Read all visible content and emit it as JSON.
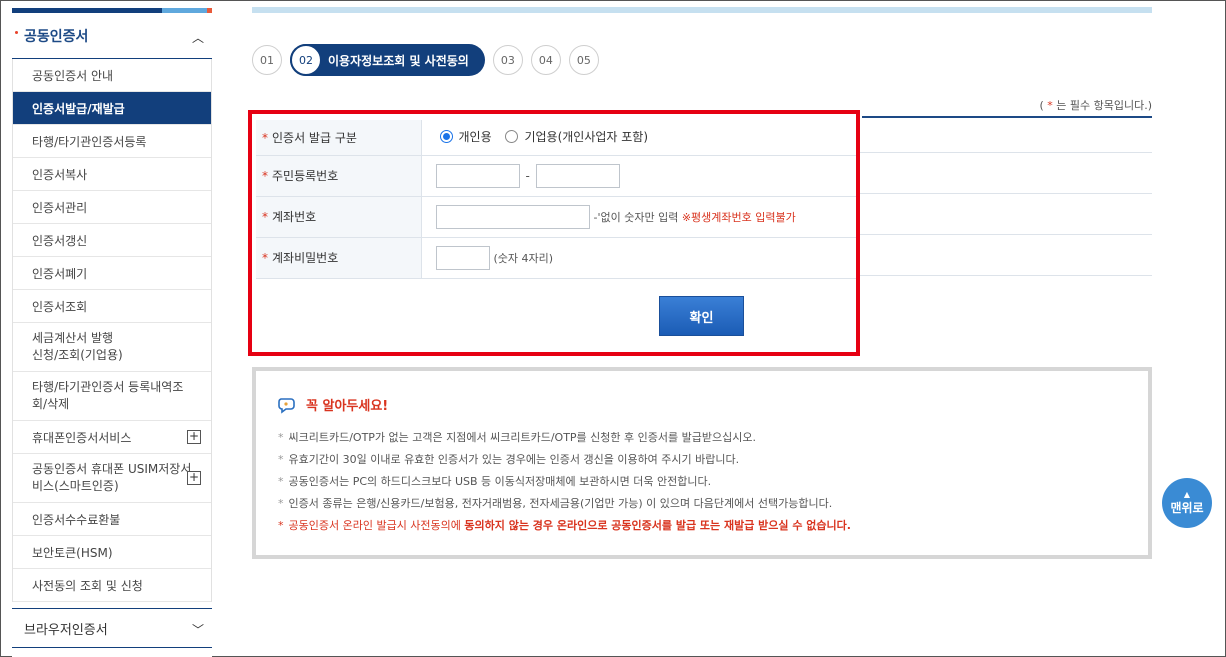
{
  "sidebar": {
    "header": "공동인증서",
    "items": [
      {
        "label": "공동인증서 안내"
      },
      {
        "label": "인증서발급/재발급"
      },
      {
        "label": "타행/타기관인증서등록"
      },
      {
        "label": "인증서복사"
      },
      {
        "label": "인증서관리"
      },
      {
        "label": "인증서갱신"
      },
      {
        "label": "인증서폐기"
      },
      {
        "label": "인증서조회"
      },
      {
        "label": "세금계산서 발행\n신청/조회(기업용)"
      },
      {
        "label": "타행/타기관인증서 등록내역조\n회/삭제"
      },
      {
        "label": "휴대폰인증서서비스"
      },
      {
        "label": "공동인증서 휴대폰 USIM저장서\n비스(스마트인증)"
      },
      {
        "label": "인증서수수료환불"
      },
      {
        "label": "보안토큰(HSM)"
      },
      {
        "label": "사전동의 조회 및 신청"
      }
    ],
    "footer": "브라우저인증서"
  },
  "steps": {
    "s1": "01",
    "s2": "02",
    "s2_label": "이용자정보조회 및 사전동의",
    "s3": "03",
    "s4": "04",
    "s5": "05"
  },
  "required_note": {
    "open": "( ",
    "star": "*",
    "text": " 는 필수 항목입니다.)"
  },
  "form": {
    "star": "*",
    "type_label": "인증서 발급 구분",
    "radio_personal": "개인용",
    "radio_business": "기업용(개인사업자 포함)",
    "rrn_label": "주민등록번호",
    "rrn_dash": "-",
    "account_label": "계좌번호",
    "account_hint": "-'없이 숫자만 입력",
    "account_warn": "※평생계좌번호 입력불가",
    "pw_label": "계좌비밀번호",
    "pw_hint": "(숫자 4자리)",
    "confirm": "확인"
  },
  "notice": {
    "title": "꼭 알아두세요!",
    "bullet": "*",
    "items": [
      "씨크리트카드/OTP가 없는 고객은 지점에서 씨크리트카드/OTP를 신청한 후 인증서를 발급받으십시오.",
      "유효기간이 30일 이내로 유효한 인증서가 있는 경우에는 인증서 갱신을 이용하여 주시기 바랍니다.",
      "공동인증서는 PC의 하드디스크보다 USB 등 이동식저장매체에 보관하시면 더욱 안전합니다.",
      "인증서 종류는 은행/신용카드/보험용, 전자거래범용, 전자세금용(기업만 가능) 이 있으며 다음단계에서 선택가능합니다."
    ],
    "red_pre": "공동인증서 온라인 발급시 사전동의에 ",
    "red_strong": "동의하지 않는 경우 온라인으로 공동인증서를 발급 또는 재발급 받으실 수 없습니다."
  },
  "top_button": "맨위로",
  "colors": {
    "primary": "#123f7c",
    "highlight_border": "#e60012",
    "warn": "#d9341f"
  }
}
